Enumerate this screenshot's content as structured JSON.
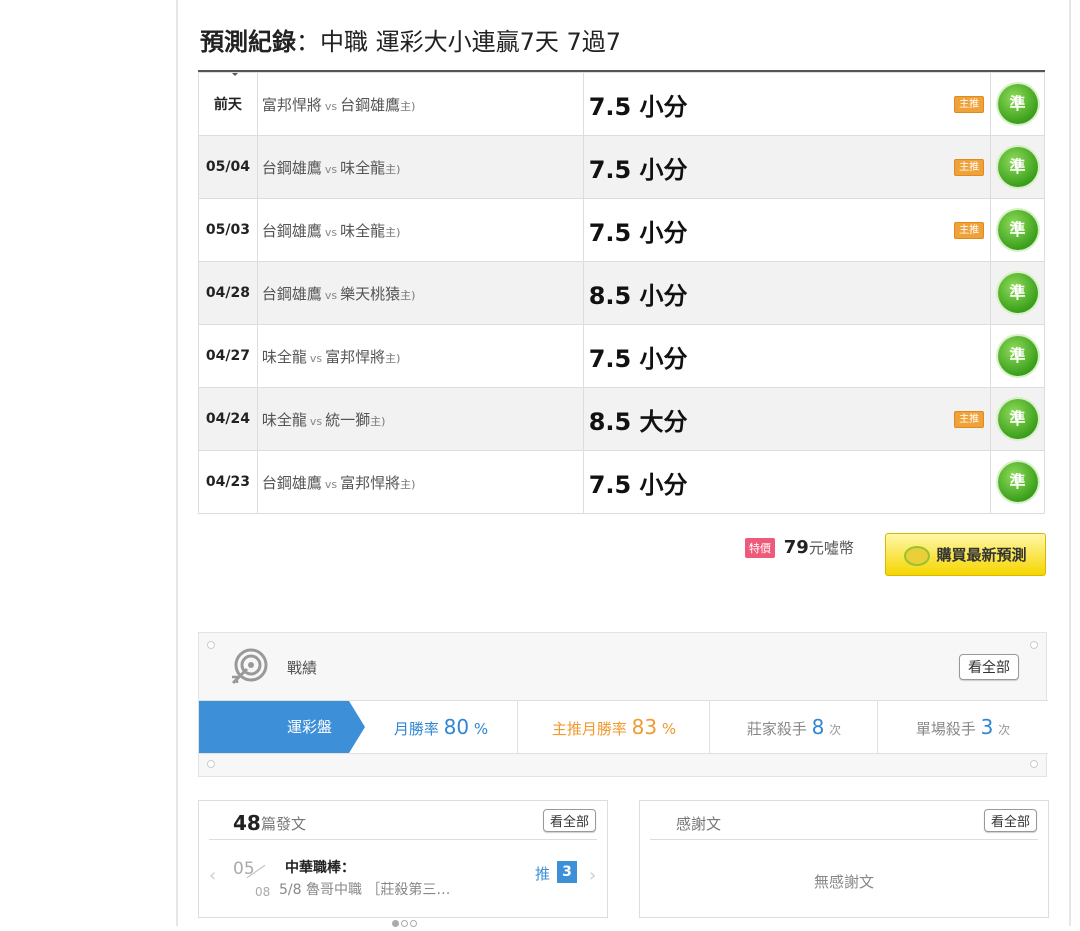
{
  "header": {
    "title_bold": "預測紀錄",
    "title_rest": "：中職 運彩大小連贏7天 7過7"
  },
  "records": [
    {
      "date": "前天",
      "team_a": "富邦悍將",
      "vs": "vs",
      "team_b": "台鋼雄鷹",
      "host": "主)",
      "pick": "7.5 小分",
      "main_badge": "主推",
      "result": "準"
    },
    {
      "date": "05/04",
      "team_a": "台鋼雄鷹",
      "vs": "vs",
      "team_b": "味全龍",
      "host": "主)",
      "pick": "7.5 小分",
      "main_badge": "主推",
      "result": "準"
    },
    {
      "date": "05/03",
      "team_a": "台鋼雄鷹",
      "vs": "vs",
      "team_b": "味全龍",
      "host": "主)",
      "pick": "7.5 小分",
      "main_badge": "主推",
      "result": "準"
    },
    {
      "date": "04/28",
      "team_a": "台鋼雄鷹",
      "vs": "vs",
      "team_b": "樂天桃猿",
      "host": "主)",
      "pick": "8.5 小分",
      "main_badge": "",
      "result": "準"
    },
    {
      "date": "04/27",
      "team_a": "味全龍",
      "vs": "vs",
      "team_b": "富邦悍將",
      "host": "主)",
      "pick": "7.5 小分",
      "main_badge": "",
      "result": "準"
    },
    {
      "date": "04/24",
      "team_a": "味全龍",
      "vs": "vs",
      "team_b": "統一獅",
      "host": "主)",
      "pick": "8.5 大分",
      "main_badge": "主推",
      "result": "準"
    },
    {
      "date": "04/23",
      "team_a": "台鋼雄鷹",
      "vs": "vs",
      "team_b": "富邦悍將",
      "host": "主)",
      "pick": "7.5 小分",
      "main_badge": "",
      "result": "準"
    }
  ],
  "price": {
    "sale_tag": "特價",
    "amount": "79",
    "unit": "元噓幣"
  },
  "buy_button": {
    "label": "購買最新預測"
  },
  "stats": {
    "title": "戰績",
    "view_all": "看全部",
    "panel_label": "運彩盤",
    "monthly_label": "月勝率",
    "monthly_value": "80",
    "monthly_unit": "%",
    "main_label": "主推月勝率",
    "main_value": "83",
    "main_unit": "%",
    "banker_label": "莊家殺手",
    "banker_value": "8",
    "banker_unit": "次",
    "single_label": "單場殺手",
    "single_value": "3",
    "single_unit": "次"
  },
  "posts": {
    "count": "48",
    "label": "篇發文",
    "view_all": "看全部",
    "item": {
      "month": "05",
      "day": "08",
      "title": "中華職棒：",
      "subtitle": "5/8 魯哥中職 ［莊殺第三…",
      "push_label": "推",
      "push_count": "3"
    }
  },
  "thanks": {
    "label": "感謝文",
    "view_all": "看全部",
    "empty": "無感謝文"
  },
  "colors": {
    "accent_blue": "#3d8fd7",
    "accent_orange": "#f09a30",
    "success_green": "#3ba01c",
    "buy_yellow": "#f5d600"
  }
}
